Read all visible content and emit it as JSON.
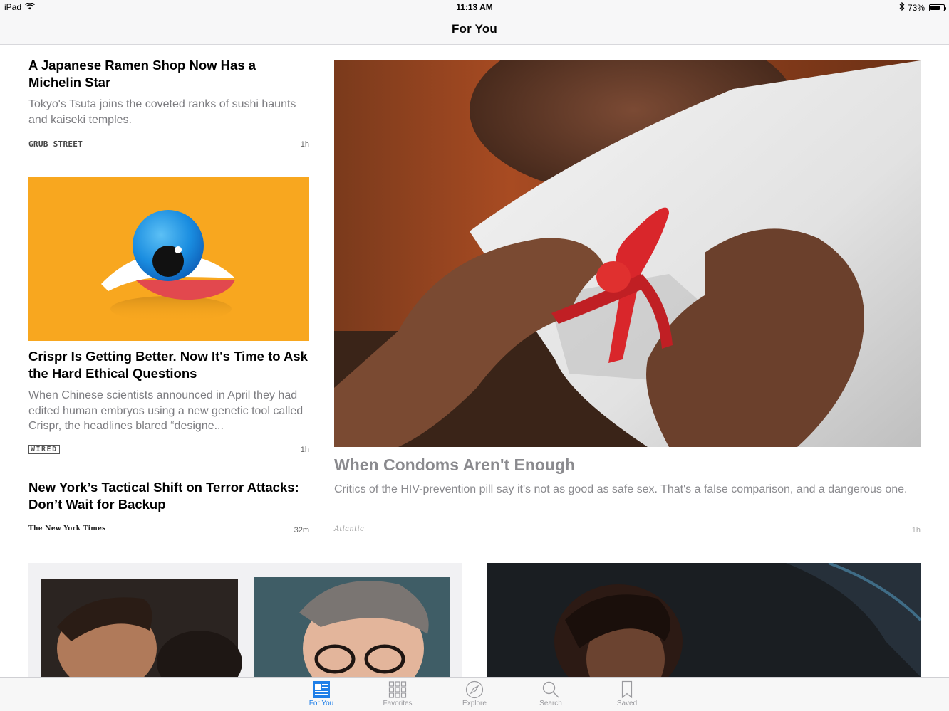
{
  "status_bar": {
    "device": "iPad",
    "time": "11:13 AM",
    "battery": "73%",
    "battery_level": 0.73
  },
  "nav": {
    "title": "For You"
  },
  "stories": [
    {
      "headline": "A Japanese Ramen Shop Now Has a Michelin Star",
      "excerpt": "Tokyo's Tsuta joins the coveted ranks of sushi haunts and kaiseki temples.",
      "source": "GRUB STREET",
      "age": "1h"
    },
    {
      "headline": "Crispr Is Getting Better. Now It's Time to Ask the Hard Ethical Questions",
      "excerpt": "When Chinese scientists announced in April they had edited human embryos using a new genetic tool called Crispr, the headlines blared “designe...",
      "source": "WIRED",
      "age": "1h"
    },
    {
      "headline": "New York’s Tactical Shift on Terror Attacks: Don’t Wait for Backup",
      "source": "The New York Times",
      "age": "32m"
    },
    {
      "headline": "When Condoms Aren't Enough",
      "excerpt": "Critics of the HIV-prevention pill say it's not as good as safe sex. That's a false comparison, and a dangerous one.",
      "source": "Atlantic",
      "age": "1h"
    }
  ],
  "tabs": [
    {
      "label": "For You",
      "icon": "for-you-icon",
      "active": true
    },
    {
      "label": "Favorites",
      "icon": "favorites-grid-icon",
      "active": false
    },
    {
      "label": "Explore",
      "icon": "compass-icon",
      "active": false
    },
    {
      "label": "Search",
      "icon": "search-icon",
      "active": false
    },
    {
      "label": "Saved",
      "icon": "bookmark-icon",
      "active": false
    }
  ],
  "colors": {
    "accent": "#1f7fe8",
    "tab_inactive": "#9a9a9e",
    "crispr_background": "#f8a71f",
    "excerpt_gray": "#7c7c80"
  }
}
